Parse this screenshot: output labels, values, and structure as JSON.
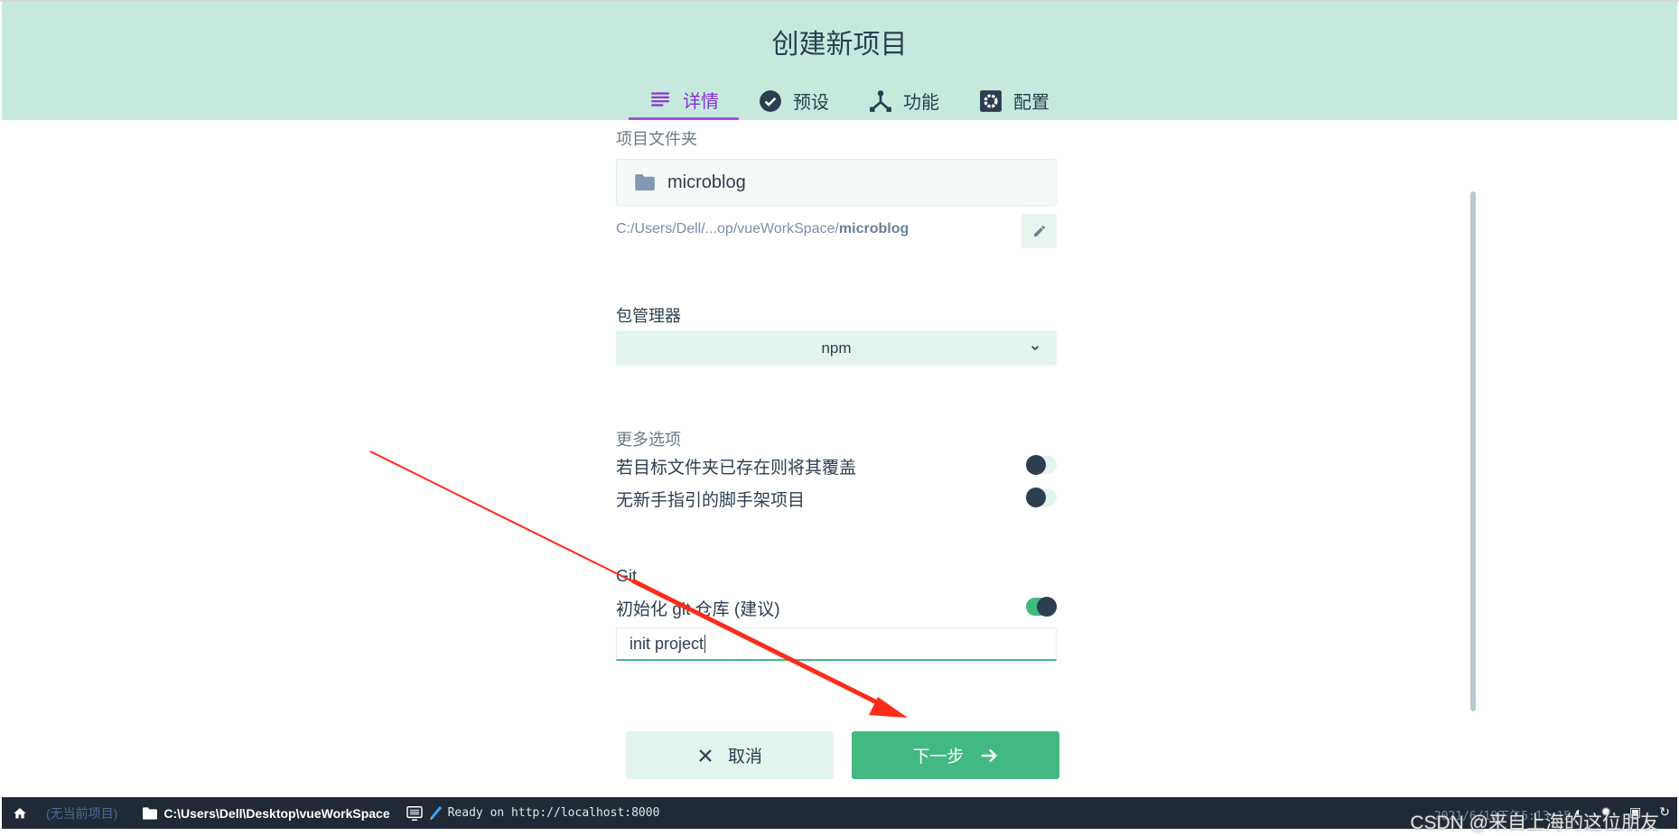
{
  "header": {
    "title": "创建新项目",
    "tabs": [
      {
        "label": "详情",
        "icon": "details-list-icon",
        "active": true
      },
      {
        "label": "预设",
        "icon": "check-circle-icon"
      },
      {
        "label": "功能",
        "icon": "fork-icon"
      },
      {
        "label": "配置",
        "icon": "gear-box-icon"
      }
    ]
  },
  "folder": {
    "label": "项目文件夹",
    "value": "microblog",
    "path_prefix": "C:/Users/Dell/...op/vueWorkSpace/",
    "path_name": "microblog"
  },
  "package_manager": {
    "label": "包管理器",
    "selected": "npm"
  },
  "more_options": {
    "label": "更多选项",
    "options": [
      {
        "label": "若目标文件夹已存在则将其覆盖",
        "on": false
      },
      {
        "label": "无新手指引的脚手架项目",
        "on": false
      }
    ]
  },
  "git": {
    "label": "Git",
    "init_label": "初始化 git 仓库 (建议)",
    "init_on": true,
    "commit_message": "init project"
  },
  "actions": {
    "cancel": "取消",
    "next": "下一步"
  },
  "statusbar": {
    "project": "(无当前项目)",
    "cwd": "C:\\Users\\Dell\\Desktop\\vueWorkSpace",
    "log": "Ready on http://localhost:8000",
    "time": "2021/6/19下午5:13:15"
  },
  "watermark": "CSDN @来自上海的这位朋友",
  "colors": {
    "header_bg": "#c5eadd",
    "accent": "#42b983",
    "tab_active": "#8b2fd6",
    "dark": "#2c3e50",
    "annotation_arrow": "#ff2a1a"
  }
}
